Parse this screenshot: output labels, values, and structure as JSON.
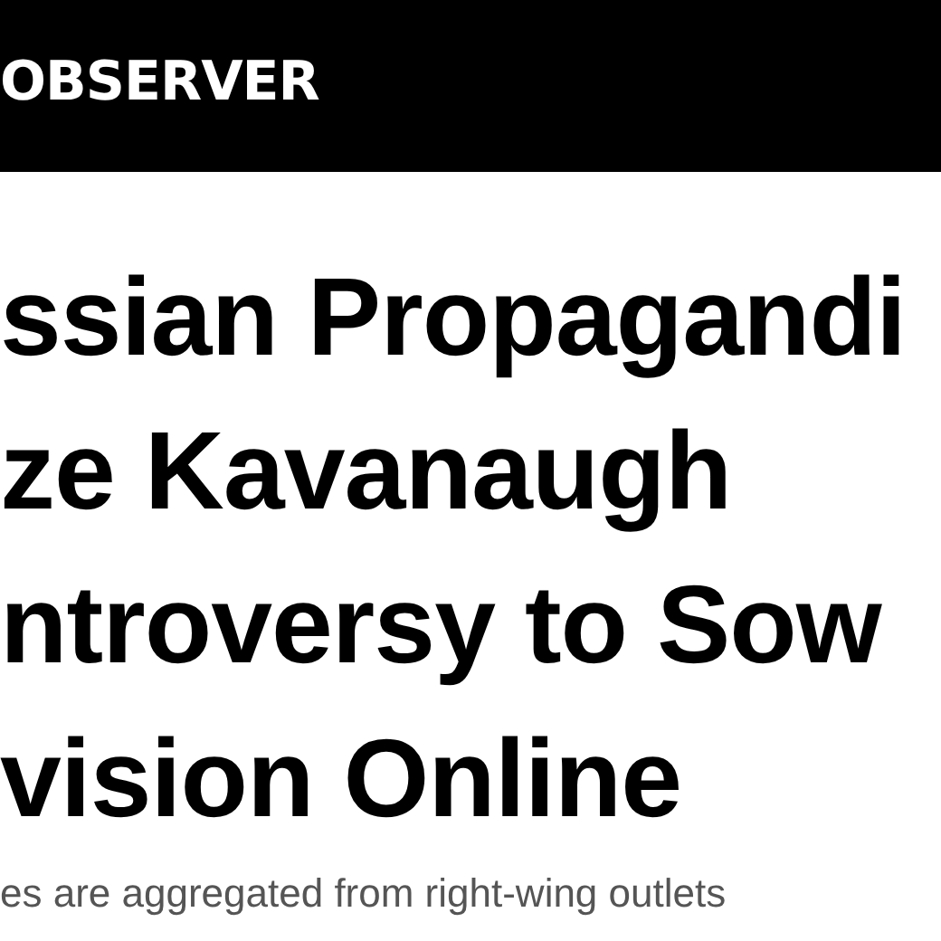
{
  "header": {
    "logo": "OBSERVER"
  },
  "headline": {
    "lines": [
      "ssian Propagandi",
      "ze Kavanaugh",
      "ntroversy to Sow",
      "vision Online"
    ]
  },
  "dek": "es are aggregated from right-wing outlets"
}
